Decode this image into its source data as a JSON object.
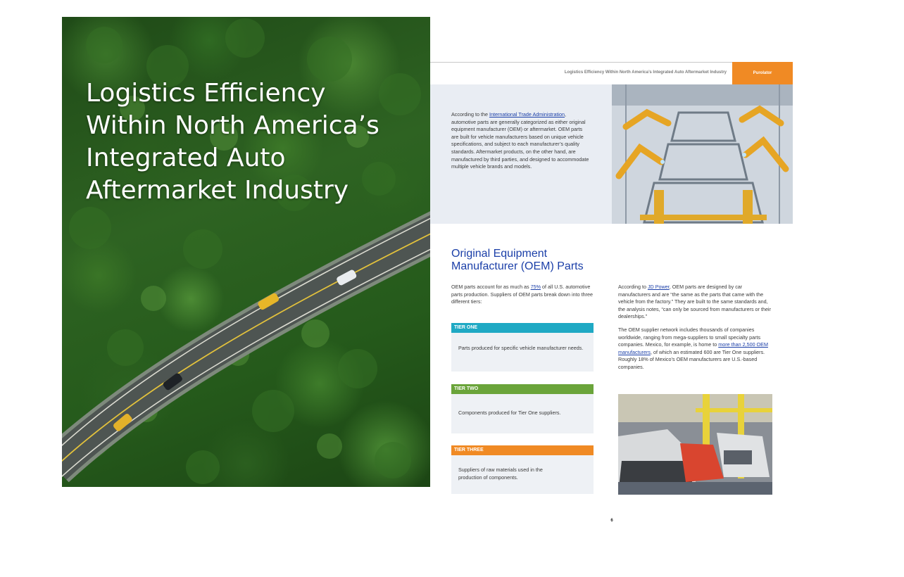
{
  "cover": {
    "title_lines": [
      "Logistics Efficiency",
      "Within North America’s",
      "Integrated Auto",
      "Aftermarket Industry"
    ],
    "image": "aerial-forest-highway"
  },
  "page": {
    "header_title": "Logistics Efficiency Within North America’s Integrated Auto Aftermarket Industry",
    "brand": "Purolator",
    "brand_color": "#f08a24",
    "heading_color": "#1b3fa8",
    "intro": {
      "before": "According to the ",
      "link": "International Trade Administration",
      "after": ", automotive parts are generally categorized as either original equipment manufacturer (OEM) or aftermarket. OEM parts are built for vehicle manufacturers based on unique vehicle specifications, and subject to each manufacturer’s quality standards. Aftermarket products, on the other hand, are manufactured by third parties, and designed to accommodate multiple vehicle brands and models."
    },
    "factory_image": "robotic-car-assembly-line",
    "section_heading_lines": [
      "Original Equipment",
      "Manufacturer (OEM) Parts"
    ],
    "oem_intro": {
      "before": "OEM parts account for as much as ",
      "link": "75%",
      "after": " of all U.S. automotive parts production. Suppliers of OEM parts break down into three different tiers:"
    },
    "tiers": [
      {
        "label": "TIER ONE",
        "text": "Parts produced for specific vehicle manufacturer needs.",
        "color": "#1fa9c4"
      },
      {
        "label": "TIER TWO",
        "text": "Components produced for Tier One suppliers.",
        "color": "#6aa43a"
      },
      {
        "label": "TIER THREE",
        "text": "Suppliers of raw materials used in the production of components.",
        "color": "#f08a24"
      }
    ],
    "right_p1": {
      "before": "According to ",
      "link": "JD Power",
      "after": ", OEM parts are designed by car manufacturers and are “the same as the parts that came with the vehicle from the factory.” They are built to the same standards and, the analysis notes, “can only be sourced from manufacturers or their dealerships.”"
    },
    "right_p2": {
      "before": "The OEM supplier network includes thousands of companies worldwide, ranging from mega-suppliers to small specialty parts companies. Mexico, for example, is home to ",
      "link": "more than 2,500 OEM manufacturers",
      "after": ", of which an estimated 600 are Tier One suppliers. Roughly 18% of Mexico’s OEM manufacturers are U.S.-based companies."
    },
    "car_image": "car-factory-production-line",
    "page_number": "6"
  }
}
